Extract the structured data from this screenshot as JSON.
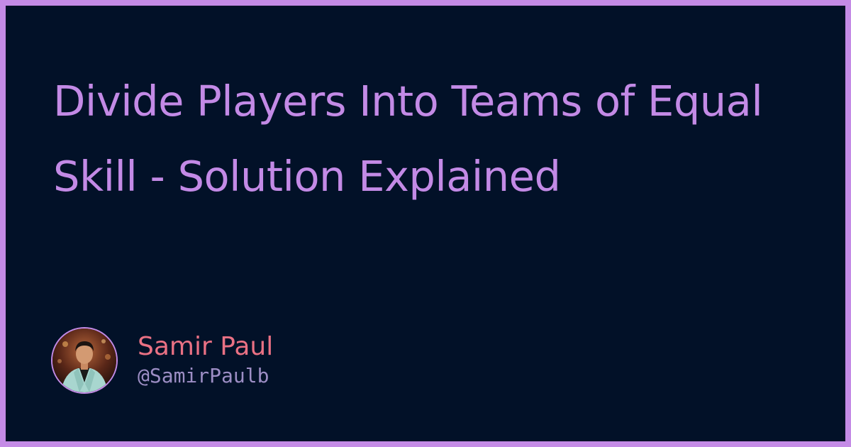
{
  "title": "Divide Players Into Teams of Equal Skill - Solution Explained",
  "author": {
    "name": "Samir Paul",
    "handle": "@SamirPaulb",
    "avatar_icon": "author-photo"
  },
  "colors": {
    "frame": "#c48be6",
    "background": "#021128",
    "title": "#c38ae6",
    "name": "#ea7184",
    "handle": "#9d8ec5"
  }
}
